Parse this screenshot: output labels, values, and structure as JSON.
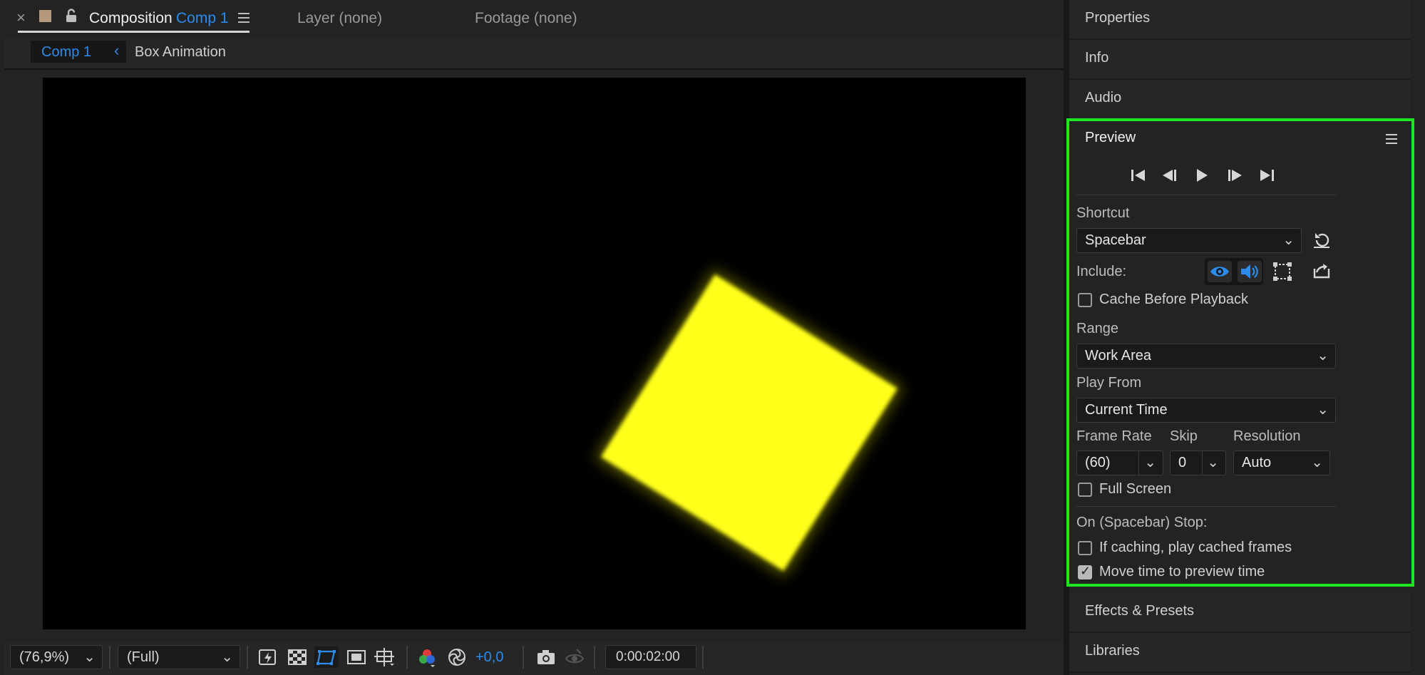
{
  "tabs": {
    "close_glyph": "×",
    "composition_label": "Composition",
    "composition_name": "Comp 1",
    "layer_label": "Layer (none)",
    "footage_label": "Footage (none)"
  },
  "breadcrumb": {
    "current": "Comp 1",
    "arrow": "‹",
    "parent": "Box Animation"
  },
  "viewer": {
    "background_color": "#000000",
    "shape_color": "#ffff1a",
    "shape_rotation_deg": 32
  },
  "bottom_toolbar": {
    "zoom": "(76,9%)",
    "resolution": "(Full)",
    "exposure": "+0,0",
    "timecode": "0:00:02:00"
  },
  "right_panel": {
    "top_sections": [
      "Properties",
      "Info",
      "Audio"
    ],
    "bottom_sections": [
      "Effects & Presets",
      "Libraries"
    ]
  },
  "preview": {
    "title": "Preview",
    "highlight_color": "#1fe61f",
    "shortcut_label": "Shortcut",
    "shortcut_value": "Spacebar",
    "include_label": "Include:",
    "cache_before_playback": {
      "label": "Cache Before Playback",
      "checked": false
    },
    "range_label": "Range",
    "range_value": "Work Area",
    "play_from_label": "Play From",
    "play_from_value": "Current Time",
    "frame_rate_label": "Frame Rate",
    "frame_rate_value": "(60)",
    "skip_label": "Skip",
    "skip_value": "0",
    "resolution_label": "Resolution",
    "resolution_value": "Auto",
    "full_screen": {
      "label": "Full Screen",
      "checked": false
    },
    "stop_label": "On (Spacebar) Stop:",
    "if_caching": {
      "label": "If caching, play cached frames",
      "checked": false
    },
    "move_time": {
      "label": "Move time to preview time",
      "checked": true
    }
  },
  "icons": {
    "accent": "#2d8ceb",
    "playback": [
      "first-frame-icon",
      "previous-frame-icon",
      "play-icon",
      "next-frame-icon",
      "last-frame-icon"
    ]
  }
}
